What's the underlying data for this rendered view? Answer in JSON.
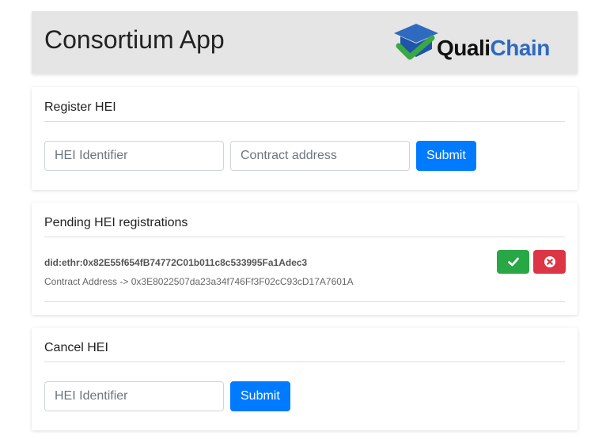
{
  "header": {
    "title": "Consortium App",
    "logo": {
      "text_part1": "Quali",
      "text_part2": "Chain",
      "icon": "graduation-cap-check-icon"
    }
  },
  "register": {
    "title": "Register HEI",
    "hei_placeholder": "HEI Identifier",
    "contract_placeholder": "Contract address",
    "submit_label": "Submit"
  },
  "pending": {
    "title": "Pending HEI registrations",
    "items": [
      {
        "did": "did:ethr:0x82E55f654fB74772C01b011c8c533995Fa1Adec3",
        "contract_line": "Contract Address -> 0x3E8022507da23a34f746Ff3F02cC93cD17A7601A",
        "approve_icon": "check-icon",
        "reject_icon": "times-circle-icon"
      }
    ]
  },
  "cancel": {
    "title": "Cancel HEI",
    "hei_placeholder": "HEI Identifier",
    "submit_label": "Submit"
  },
  "colors": {
    "primary": "#007bff",
    "success": "#28a745",
    "danger": "#dc3545",
    "header_bg": "#e5e5e5",
    "brand_blue": "#2e6ac0",
    "brand_green": "#3aa845"
  }
}
